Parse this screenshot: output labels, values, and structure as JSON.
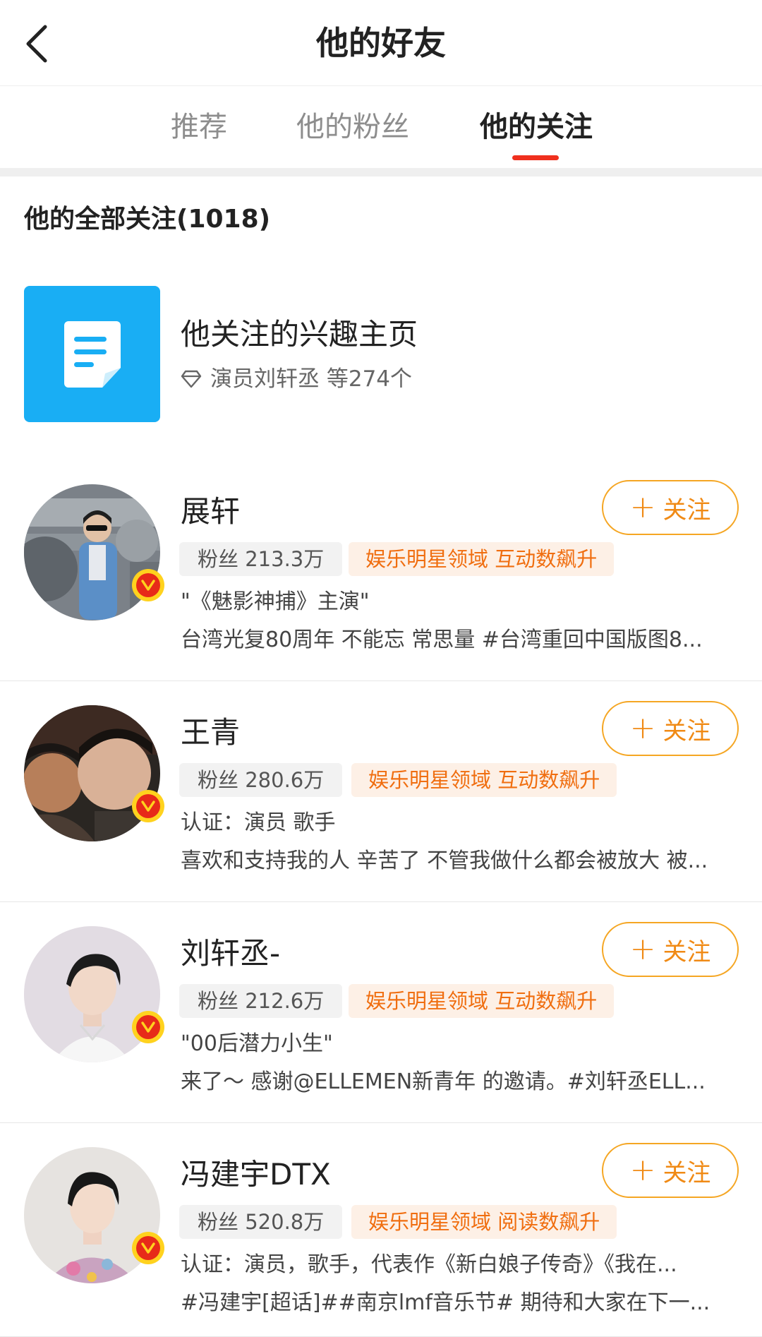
{
  "header": {
    "title": "他的好友"
  },
  "tabs": [
    {
      "label": "推荐",
      "active": false
    },
    {
      "label": "他的粉丝",
      "active": false
    },
    {
      "label": "他的关注",
      "active": true
    }
  ],
  "section": {
    "title": "他的全部关注(1018)"
  },
  "interest": {
    "title": "他关注的兴趣主页",
    "subtitle": "演员刘轩丞 等274个",
    "icon": "document-icon",
    "icon_bg": "#19aef4"
  },
  "follow_label": "关注",
  "accent_color": "#f08a15",
  "users": [
    {
      "name": "展轩",
      "fans": "粉丝 213.3万",
      "tag": "娱乐明星领域 互动数飙升",
      "desc": "\"《魅影神捕》主演\"",
      "post": "台湾光复80周年 不能忘 常思量 #台湾重回中国版图8..."
    },
    {
      "name": "王青",
      "fans": "粉丝 280.6万",
      "tag": "娱乐明星领域 互动数飙升",
      "desc": "认证：演员 歌手",
      "post": "喜欢和支持我的人 辛苦了 不管我做什么都会被放大 被..."
    },
    {
      "name": "刘轩丞-",
      "fans": "粉丝 212.6万",
      "tag": "娱乐明星领域 互动数飙升",
      "desc": "\"00后潜力小生\"",
      "post": "来了～ 感谢@ELLEMEN新青年 的邀请。#刘轩丞ELL..."
    },
    {
      "name": "冯建宇DTX",
      "fans": "粉丝 520.8万",
      "tag": "娱乐明星领域 阅读数飙升",
      "desc": "认证：演员，歌手，代表作《新白娘子传奇》《我在...",
      "post": "#冯建宇[超话]##南京lmf音乐节# 期待和大家在下一..."
    }
  ]
}
